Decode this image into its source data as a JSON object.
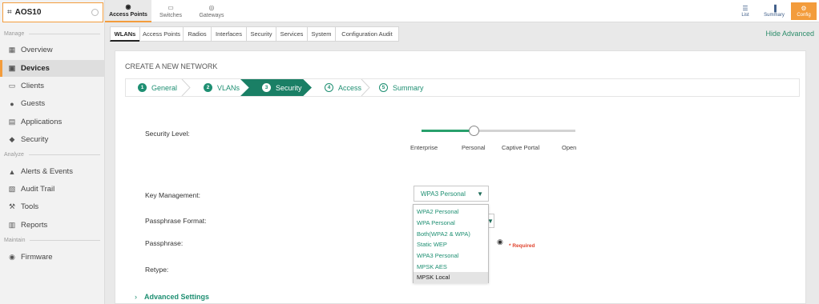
{
  "org": {
    "name": "AOS10"
  },
  "sidebar": {
    "sections": [
      {
        "label": "Manage"
      },
      {
        "label": "Analyze"
      },
      {
        "label": "Maintain"
      }
    ],
    "items": [
      {
        "label": "Overview",
        "icon": "grid-icon"
      },
      {
        "label": "Devices",
        "icon": "device-icon"
      },
      {
        "label": "Clients",
        "icon": "monitor-icon"
      },
      {
        "label": "Guests",
        "icon": "users-icon"
      },
      {
        "label": "Applications",
        "icon": "apps-icon"
      },
      {
        "label": "Security",
        "icon": "shield-icon"
      },
      {
        "label": "Alerts & Events",
        "icon": "bell-icon"
      },
      {
        "label": "Audit Trail",
        "icon": "document-icon"
      },
      {
        "label": "Tools",
        "icon": "wrench-icon"
      },
      {
        "label": "Reports",
        "icon": "report-icon"
      },
      {
        "label": "Firmware",
        "icon": "firmware-icon"
      }
    ]
  },
  "topbar": {
    "tabs": [
      {
        "label": "Access Points",
        "icon": "access-point-icon"
      },
      {
        "label": "Switches",
        "icon": "switch-icon"
      },
      {
        "label": "Gateways",
        "icon": "gateway-icon"
      }
    ],
    "right": [
      {
        "label": "List",
        "icon": "list-icon"
      },
      {
        "label": "Summary",
        "icon": "bar-chart-icon"
      },
      {
        "label": "Config",
        "icon": "gear-icon"
      }
    ]
  },
  "subnav": {
    "tabs": [
      "WLANs",
      "Access Points",
      "Radios",
      "Interfaces",
      "Security",
      "Services",
      "System",
      "Configuration Audit"
    ],
    "hide_advanced": "Hide Advanced"
  },
  "wizard": {
    "title": "CREATE A NEW NETWORK",
    "steps": [
      {
        "num": "1",
        "label": "General"
      },
      {
        "num": "2",
        "label": "VLANs"
      },
      {
        "num": "3",
        "label": "Security"
      },
      {
        "num": "4",
        "label": "Access"
      },
      {
        "num": "5",
        "label": "Summary"
      }
    ]
  },
  "form": {
    "security_level_label": "Security Level:",
    "slider_ticks": [
      "Enterprise",
      "Personal",
      "Captive Portal",
      "Open"
    ],
    "slider_selected": "Personal",
    "key_management_label": "Key Management:",
    "key_management_value": "WPA3 Personal",
    "passphrase_format_label": "Passphrase Format:",
    "passphrase_label": "Passphrase:",
    "retype_label": "Retype:",
    "required_text": "* Required",
    "advanced_settings": "Advanced Settings",
    "dropdown_options": [
      "WPA2 Personal",
      "WPA Personal",
      "Both(WPA2 & WPA)",
      "Static WEP",
      "WPA3 Personal",
      "MPSK AES",
      "MPSK Local"
    ]
  }
}
